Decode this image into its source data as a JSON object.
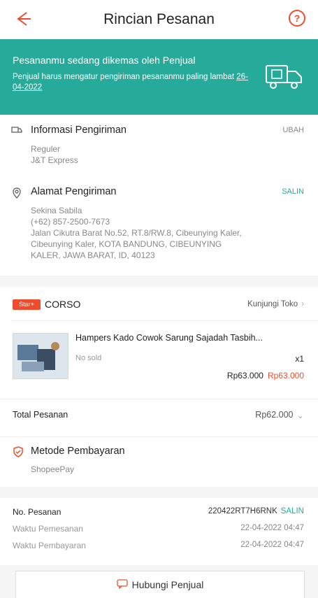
{
  "header": {
    "title": "Rincian Pesanan",
    "help_glyph": "?"
  },
  "banner": {
    "title": "Pesananmu sedang dikemas oleh Penjual",
    "subtitle": "Penjual harus mengatur pengiriman pesananmu paling lambat",
    "deadline": "26-04-2022"
  },
  "shipping_info": {
    "title": "Informasi Pengiriman",
    "action": "UBAH",
    "service": "Reguler",
    "courier": "J&T Express"
  },
  "address": {
    "title": "Alamat Pengiriman",
    "action": "SALIN",
    "name": "Sekina Sabila",
    "phone": "(+62) 857-2500-7673",
    "line1": "Jalan Cikutra Barat No.52, RT.8/RW.8, Cibeunying Kaler,",
    "line2": "Cibeunying Kaler, KOTA BANDUNG, CIBEUNYING",
    "line3": "KALER, JAWA BARAT, ID, 40123"
  },
  "shop": {
    "badge": "Star+",
    "name": "CORSO",
    "visit": "Kunjungi Toko",
    "product": {
      "name": "Hampers Kado Cowok Sarung Sajadah Tasbih...",
      "variant": "No sold",
      "qty": "x1",
      "price": "Rp63.000",
      "old_price": "Rp63.000"
    }
  },
  "total": {
    "label": "Total Pesanan",
    "value": "Rp62.000"
  },
  "payment": {
    "title": "Metode Pembayaran",
    "method": "ShopeePay"
  },
  "order": {
    "no_label": "No. Pesanan",
    "no_value": "220422RT7H6RNK",
    "copy": "SALIN",
    "time_label": "Waktu Pemesanan",
    "time_value": "22-04-2022 04:47",
    "pay_label": "Waktu Pembayaran",
    "pay_value": "22-04-2022 04:47"
  },
  "contact": {
    "label": "Hubungi Penjual"
  },
  "colors": {
    "accent": "#ee4d2d",
    "banner": "#26aa99"
  }
}
